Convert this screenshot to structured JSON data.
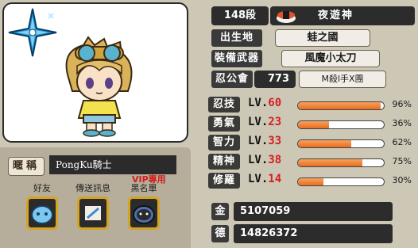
{
  "profile": {
    "level_rank": "148段",
    "job_title": "夜遊神",
    "birthplace_label": "出生地",
    "birthplace": "蛙之國",
    "weapon_label": "裝備武器",
    "weapon": "風魔小太刀",
    "guild_label": "忍公會",
    "guild_count": "773",
    "guild_name": "M殺l手X團"
  },
  "nickname": {
    "label": "暱稱",
    "value": "PongKu騎士"
  },
  "actions": [
    {
      "label": "好友"
    },
    {
      "label": "傳送訊息"
    },
    {
      "label": "黑名單"
    }
  ],
  "vip_label": "VIP專用",
  "stats": [
    {
      "name": "忍技",
      "lv_prefix": "LV.",
      "level": "60",
      "percent_text": "96%",
      "fill": 0.96
    },
    {
      "name": "勇氣",
      "lv_prefix": "LV.",
      "level": "23",
      "percent_text": "36%",
      "fill": 0.36
    },
    {
      "name": "智力",
      "lv_prefix": "LV.",
      "level": "33",
      "percent_text": "62%",
      "fill": 0.62
    },
    {
      "name": "精神",
      "lv_prefix": "LV.",
      "level": "38",
      "percent_text": "75%",
      "fill": 0.75
    },
    {
      "name": "修羅",
      "lv_prefix": "LV.",
      "level": "14",
      "percent_text": "30%",
      "fill": 0.3
    }
  ],
  "currency": [
    {
      "icon_text": "金",
      "value": "5107059"
    },
    {
      "icon_text": "德",
      "value": "14826372"
    }
  ]
}
